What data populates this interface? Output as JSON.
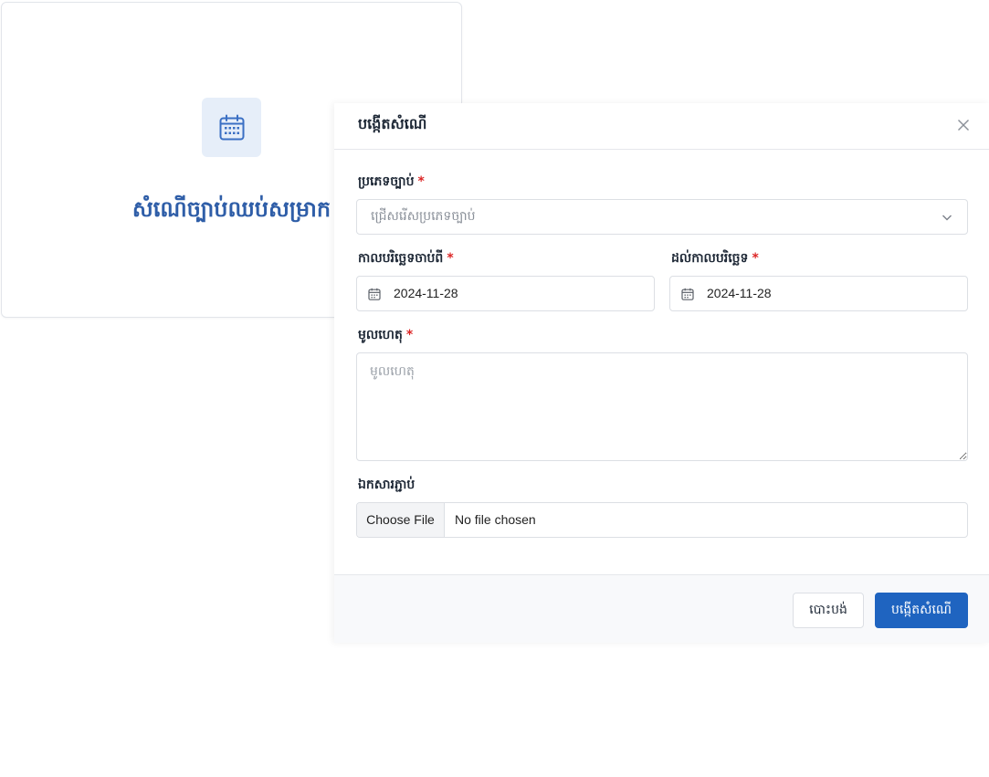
{
  "colors": {
    "primary": "#1f64c0",
    "accent_text": "#2f5ea8",
    "icon_bg": "#e6eef9",
    "icon_color": "#3a6fc4",
    "required": "#dc2626",
    "footer_bg": "#f8f9fb"
  },
  "card": {
    "icon": "calendar-icon",
    "title": "សំណើច្បាប់ឈប់សម្រាក"
  },
  "modal": {
    "title": "បង្កើតសំណើ",
    "close_icon": "close-icon",
    "leave_type": {
      "label": "ប្រភេទច្បាប់",
      "required_mark": "*",
      "placeholder": "ជ្រើសរើសប្រភេទច្បាប់",
      "icon": "chevron-down-icon"
    },
    "start_date": {
      "label": "កាលបរិច្ឆេទចាប់ពី",
      "required_mark": "*",
      "value": "2024-11-28",
      "icon": "calendar-icon"
    },
    "end_date": {
      "label": "ដល់កាលបរិច្ឆេទ",
      "required_mark": "*",
      "value": "2024-11-28",
      "icon": "calendar-icon"
    },
    "reason": {
      "label": "មូលហេតុ",
      "required_mark": "*",
      "placeholder": "មូលហេតុ"
    },
    "attachment": {
      "label": "ឯកសារភ្ជាប់",
      "button_label": "Choose File",
      "status": "No file chosen"
    },
    "footer": {
      "cancel_label": "បោះបង់",
      "submit_label": "បង្កើតសំណើ"
    }
  }
}
